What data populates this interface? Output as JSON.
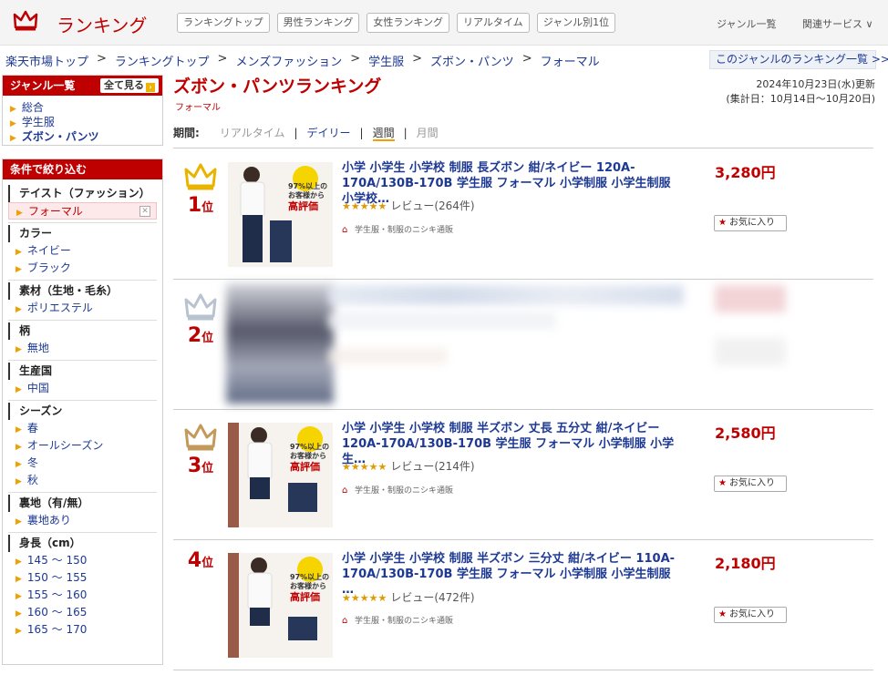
{
  "header": {
    "logo_text": "ランキング",
    "tabs": [
      "ランキングトップ",
      "男性ランキング",
      "女性ランキング",
      "リアルタイム",
      "ジャンル別1位"
    ],
    "genre_list": "ジャンル一覧",
    "related": "関連サービス ∨"
  },
  "breadcrumb": [
    "楽天市場トップ",
    "ランキングトップ",
    "メンズファッション",
    "学生服",
    "ズボン・パンツ",
    "フォーマル"
  ],
  "breadcrumb_sep": ">",
  "genre_ranking_link": "このジャンルのランキング一覧 >>",
  "sidebar": {
    "genre_title": "ジャンル一覧",
    "see_all": "全て見る",
    "see_all_icon": "›",
    "genres": [
      "総合",
      "学生服",
      "ズボン・パンツ"
    ],
    "filter_title": "条件で絞り込む",
    "sections": [
      {
        "title": "テイスト（ファッション）",
        "options": [
          "フォーマル"
        ],
        "selected": "フォーマル"
      },
      {
        "title": "カラー",
        "options": [
          "ネイビー",
          "ブラック"
        ]
      },
      {
        "title": "素材（生地・毛糸）",
        "options": [
          "ポリエステル"
        ]
      },
      {
        "title": "柄",
        "options": [
          "無地"
        ]
      },
      {
        "title": "生産国",
        "options": [
          "中国"
        ]
      },
      {
        "title": "シーズン",
        "options": [
          "春",
          "オールシーズン",
          "冬",
          "秋"
        ]
      },
      {
        "title": "裏地（有/無）",
        "options": [
          "裏地あり"
        ]
      },
      {
        "title": "身長（cm）",
        "options": [
          "145 ～ 150",
          "150 ～ 155",
          "155 ～ 160",
          "160 ～ 165",
          "165 ～ 170"
        ]
      }
    ]
  },
  "main": {
    "title": "ズボン・パンツランキング",
    "subtitle": "フォーマル",
    "updated": "2024年10月23日(水)更新",
    "aggregation": "(集計日：10月14日～10月20日)",
    "period_label": "期間:",
    "periods": [
      "リアルタイム",
      "デイリー",
      "週間",
      "月間"
    ],
    "active_period": "週間"
  },
  "items": [
    {
      "rank": "1",
      "rank_suffix": "位",
      "title": "小学 小学生 小学校 制服 長ズボン 紺/ネイビー 120A-170A/130B-170B 学生服 フォーマル 小学制服 小学生制服 小学校…",
      "stars": "★★★★★",
      "reviews": "レビュー(264件)",
      "shop": "学生服・制服のニシキ通販",
      "price": "3,280円",
      "fav": "お気に入り",
      "crown": "#e8b400"
    },
    {
      "rank": "2",
      "rank_suffix": "位",
      "blurred": true,
      "crown": "#b9c3d0"
    },
    {
      "rank": "3",
      "rank_suffix": "位",
      "title": "小学 小学生 小学校 制服 半ズボン 丈長 五分丈 紺/ネイビー 120A-170A/130B-170B 学生服 フォーマル 小学制服 小学生…",
      "stars": "★★★★★",
      "reviews": "レビュー(214件)",
      "shop": "学生服・制服のニシキ通販",
      "price": "2,580円",
      "fav": "お気に入り",
      "crown": "#c39a5a"
    },
    {
      "rank": "4",
      "rank_suffix": "位",
      "title": "小学 小学生 小学校 制服 半ズボン 三分丈 紺/ネイビー 110A-170A/130B-170B 学生服 フォーマル 小学制服 小学生制服 …",
      "stars": "★★★★★",
      "reviews": "レビュー(472件)",
      "shop": "学生服・制服のニシキ通販",
      "price": "2,180円",
      "fav": "お気に入り"
    }
  ],
  "thumb_text": {
    "line1": "97%以上の",
    "line2": "お客様から",
    "line3": "高評価"
  }
}
